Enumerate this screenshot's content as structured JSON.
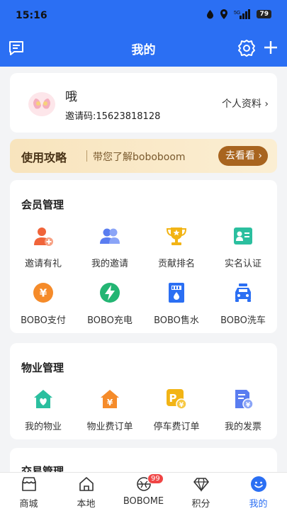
{
  "status": {
    "time": "15:16",
    "battery": "79"
  },
  "header": {
    "title": "我的"
  },
  "profile": {
    "name": "哦",
    "invite_code": "邀请码:15623818128",
    "link_label": "个人资料"
  },
  "guide": {
    "title": "使用攻略",
    "subtitle": "带您了解boboboom",
    "button": "去看看"
  },
  "member": {
    "title": "会员管理",
    "items": [
      {
        "label": "邀请有礼",
        "icon": "invite-icon"
      },
      {
        "label": "我的邀请",
        "icon": "users-icon"
      },
      {
        "label": "贡献排名",
        "icon": "trophy-icon"
      },
      {
        "label": "实名认证",
        "icon": "id-card-icon"
      },
      {
        "label": "BOBO支付",
        "icon": "yuan-coin-icon"
      },
      {
        "label": "BOBO充电",
        "icon": "lightning-icon"
      },
      {
        "label": "BOBO售水",
        "icon": "water-machine-icon"
      },
      {
        "label": "BOBO洗车",
        "icon": "car-wash-icon"
      }
    ]
  },
  "property": {
    "title": "物业管理",
    "items": [
      {
        "label": "我的物业",
        "icon": "house-heart-icon"
      },
      {
        "label": "物业费订单",
        "icon": "house-yuan-icon"
      },
      {
        "label": "停车费订单",
        "icon": "parking-icon"
      },
      {
        "label": "我的发票",
        "icon": "invoice-icon"
      }
    ]
  },
  "trade": {
    "title": "交易管理"
  },
  "tabs": [
    {
      "label": "商城",
      "icon": "shop-icon"
    },
    {
      "label": "本地",
      "icon": "home-icon"
    },
    {
      "label": "BOBOME",
      "icon": "bobome-icon",
      "badge": "99"
    },
    {
      "label": "积分",
      "icon": "diamond-icon"
    },
    {
      "label": "我的",
      "icon": "smile-icon"
    }
  ]
}
